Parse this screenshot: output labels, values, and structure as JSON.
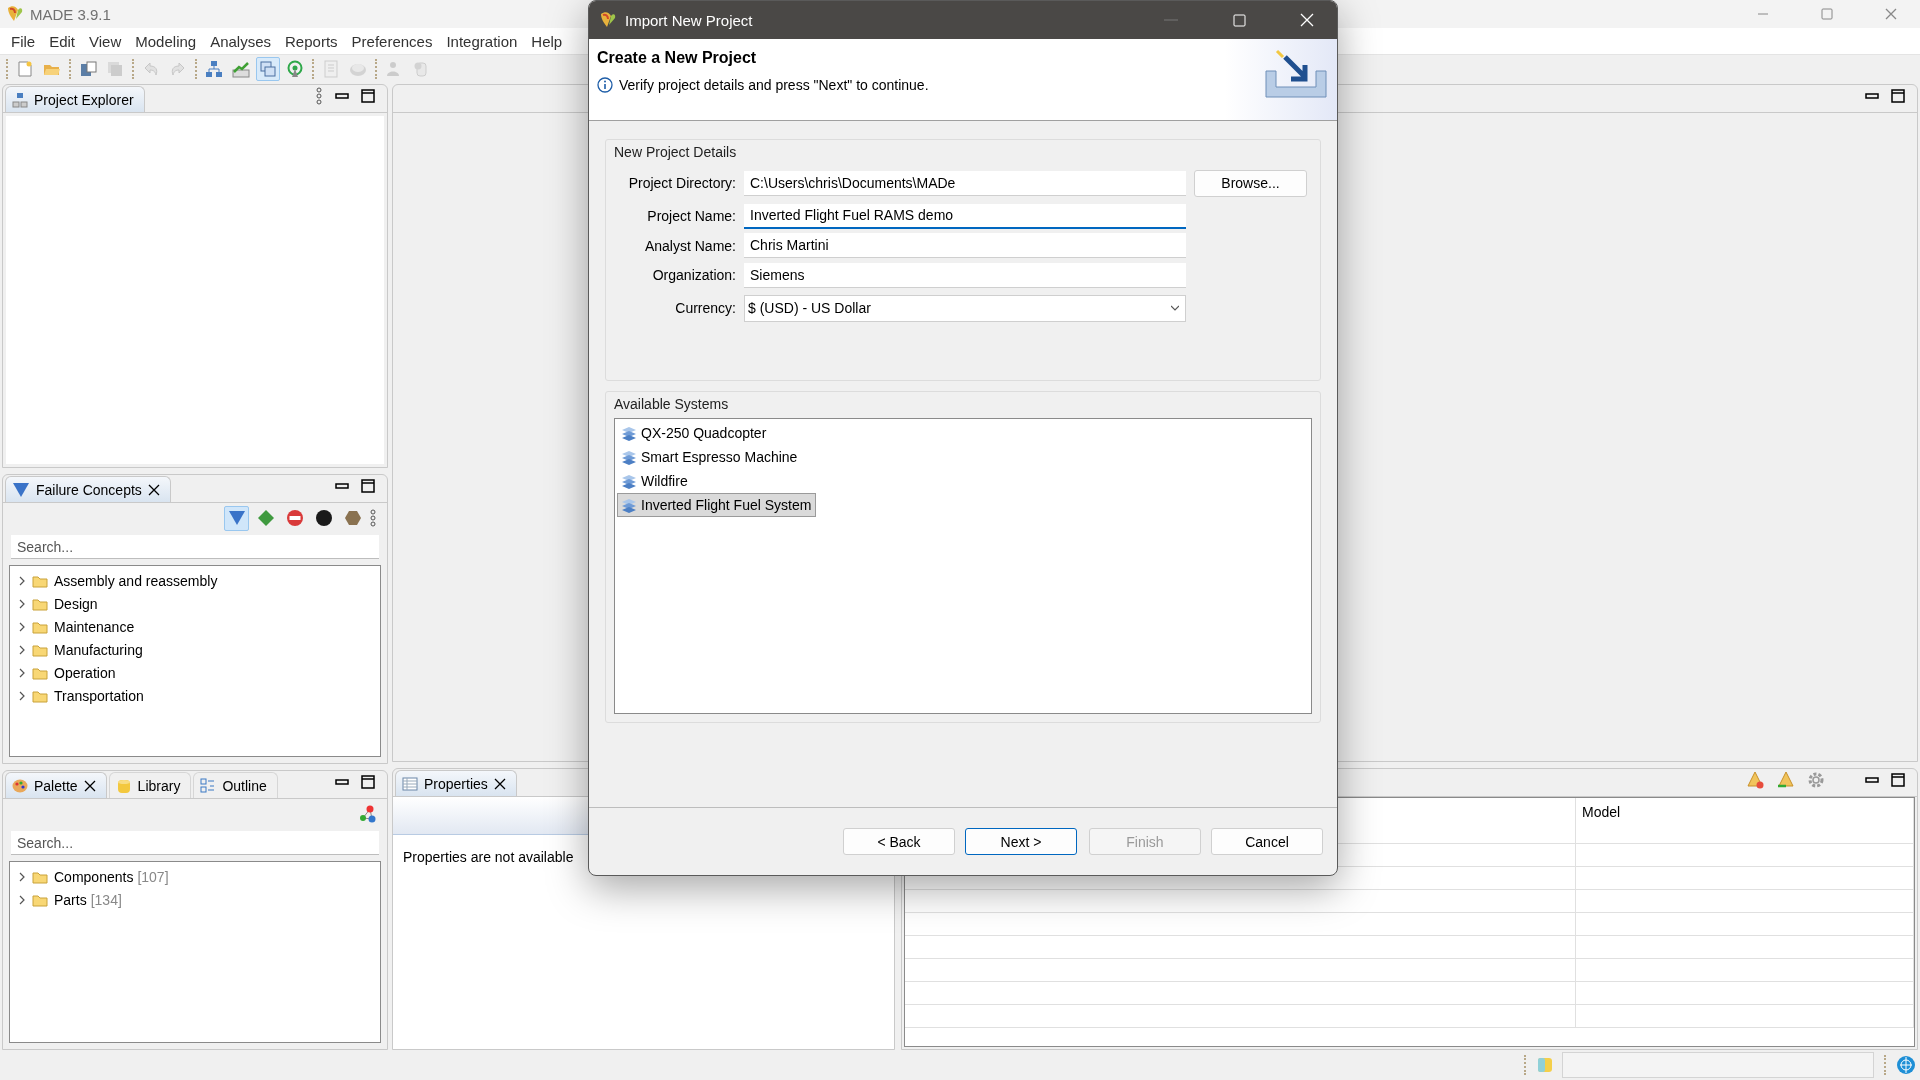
{
  "app": {
    "title": "MADE 3.9.1"
  },
  "menu": [
    "File",
    "Edit",
    "View",
    "Modeling",
    "Analyses",
    "Reports",
    "Preferences",
    "Integration",
    "Help"
  ],
  "toolbar": [
    {
      "kind": "separator"
    },
    {
      "kind": "new-file",
      "disabled": false,
      "selected": false
    },
    {
      "kind": "open-folder",
      "disabled": false,
      "selected": false
    },
    {
      "kind": "separator"
    },
    {
      "kind": "save",
      "disabled": false,
      "selected": false
    },
    {
      "kind": "save-all",
      "disabled": true,
      "selected": false
    },
    {
      "kind": "separator"
    },
    {
      "kind": "undo",
      "disabled": true,
      "selected": false
    },
    {
      "kind": "redo",
      "disabled": true,
      "selected": false
    },
    {
      "kind": "separator"
    },
    {
      "kind": "hierarchy",
      "disabled": false,
      "selected": false
    },
    {
      "kind": "chart",
      "disabled": false,
      "selected": false
    },
    {
      "kind": "windows",
      "disabled": false,
      "selected": true
    },
    {
      "kind": "antenna",
      "disabled": false,
      "selected": false
    },
    {
      "kind": "separator"
    },
    {
      "kind": "notebook",
      "disabled": true,
      "selected": false
    },
    {
      "kind": "disc",
      "disabled": true,
      "selected": false
    },
    {
      "kind": "separator"
    },
    {
      "kind": "person",
      "disabled": true,
      "selected": false
    },
    {
      "kind": "cylinder",
      "disabled": true,
      "selected": false
    }
  ],
  "project_explorer": {
    "title": "Project Explorer"
  },
  "failure_concepts": {
    "title": "Failure Concepts",
    "filters": [
      {
        "kind": "triangle",
        "selected": true
      },
      {
        "kind": "diamond",
        "selected": false
      },
      {
        "kind": "no-entry",
        "selected": false
      },
      {
        "kind": "circle",
        "selected": false
      },
      {
        "kind": "hexagon",
        "selected": false
      }
    ],
    "search": {
      "placeholder": "Search..."
    },
    "items": [
      {
        "label": "Assembly and reassembly",
        "expanded": false
      },
      {
        "label": "Design",
        "expanded": false
      },
      {
        "label": "Maintenance",
        "expanded": false
      },
      {
        "label": "Manufacturing",
        "expanded": false
      },
      {
        "label": "Operation",
        "expanded": false
      },
      {
        "label": "Transportation",
        "expanded": false
      }
    ]
  },
  "palette": {
    "tabs": [
      {
        "kind": "palette",
        "label": "Palette",
        "selected": true
      },
      {
        "kind": "library",
        "label": "Library",
        "selected": false
      },
      {
        "kind": "outline",
        "label": "Outline",
        "selected": false
      }
    ],
    "search": {
      "placeholder": "Search..."
    },
    "items": [
      {
        "label": "Components",
        "count": "[107]",
        "expanded": false
      },
      {
        "label": "Parts",
        "count": "[134]",
        "expanded": false
      }
    ]
  },
  "properties": {
    "title": "Properties",
    "message": "Properties are not available"
  },
  "problems": {
    "columns": [
      {
        "label": "Model"
      }
    ]
  },
  "dialog": {
    "title": "Import New Project",
    "heading": "Create a New Project",
    "message": "Verify project details and press \"Next\" to continue.",
    "details": {
      "title": "New Project Details",
      "browse": "Browse...",
      "fields": [
        {
          "kind": "text",
          "label": "Project Directory:",
          "value": "C:\\Users\\chris\\Documents\\MADe",
          "focused": false
        },
        {
          "kind": "text",
          "label": "Project Name:",
          "value": "Inverted Flight Fuel RAMS demo",
          "focused": true
        },
        {
          "kind": "text",
          "label": "Analyst Name:",
          "value": "Chris Martini",
          "focused": false
        },
        {
          "kind": "text",
          "label": "Organization:",
          "value": "Siemens",
          "focused": false
        },
        {
          "kind": "dropdown",
          "label": "Currency:",
          "value": "$ (USD) - US Dollar",
          "focused": false
        }
      ]
    },
    "systems": {
      "title": "Available Systems",
      "items": [
        {
          "label": "QX-250 Quadcopter",
          "selected": false
        },
        {
          "label": "Smart Espresso Machine",
          "selected": false
        },
        {
          "label": "Wildfire",
          "selected": false
        },
        {
          "label": "Inverted Flight Fuel System",
          "selected": true
        }
      ]
    },
    "buttons": [
      {
        "label": "< Back",
        "default": false,
        "disabled": false
      },
      {
        "label": "Next >",
        "default": true,
        "disabled": false
      },
      {
        "label": "Finish",
        "default": false,
        "disabled": true
      },
      {
        "label": "Cancel",
        "default": false,
        "disabled": false
      }
    ]
  }
}
